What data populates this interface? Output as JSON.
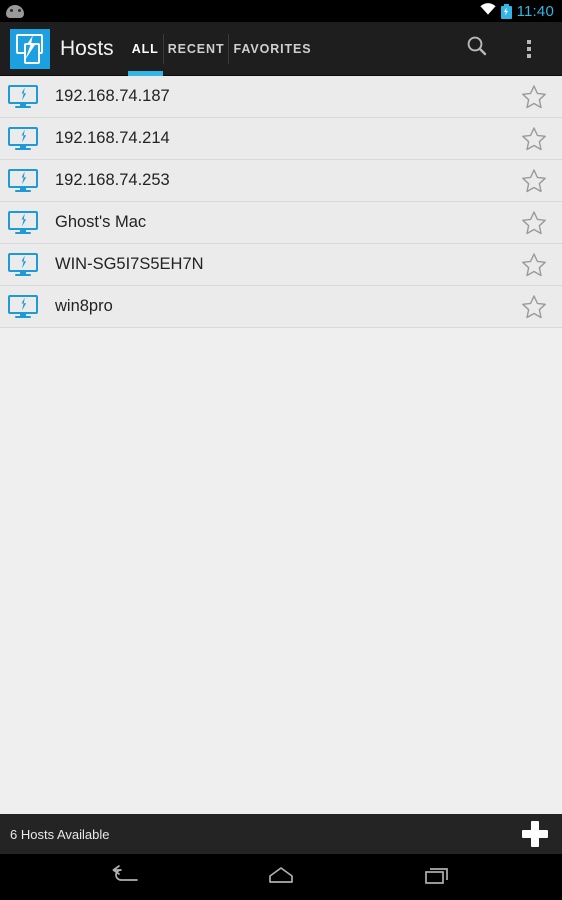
{
  "status_bar": {
    "notification_icon": "cyanogenmod-head-icon",
    "wifi_icon": "wifi-icon",
    "battery_icon": "battery-charging-icon",
    "clock": "11:40",
    "accent_color": "#33b5e5"
  },
  "action_bar": {
    "app_icon": "hosts-app-icon",
    "title": "Hosts",
    "tabs": [
      {
        "label": "ALL",
        "active": true
      },
      {
        "label": "RECENT",
        "active": false
      },
      {
        "label": "FAVORITES",
        "active": false
      }
    ],
    "search_icon": "search-icon",
    "overflow_icon": "overflow-menu-icon",
    "background_color": "#1e1e1e",
    "tab_indicator_color": "#33b5e5"
  },
  "host_list": {
    "row_icon": "monitor-bolt-icon",
    "star_icon": "star-outline-icon",
    "rows": [
      {
        "name": "192.168.74.187",
        "favorite": false
      },
      {
        "name": "192.168.74.214",
        "favorite": false
      },
      {
        "name": "192.168.74.253",
        "favorite": false
      },
      {
        "name": "Ghost's Mac",
        "favorite": false
      },
      {
        "name": "WIN-SG5I7S5EH7N",
        "favorite": false
      },
      {
        "name": "win8pro",
        "favorite": false
      }
    ],
    "row_background": "#ebebeb",
    "icon_color": "#1e9bd7"
  },
  "info_bar": {
    "status_text": "6 Hosts Available",
    "add_button": "add-host-button",
    "background_color": "#242424"
  },
  "nav_bar": {
    "back_icon": "back-icon",
    "home_icon": "home-icon",
    "recents_icon": "recents-icon"
  }
}
